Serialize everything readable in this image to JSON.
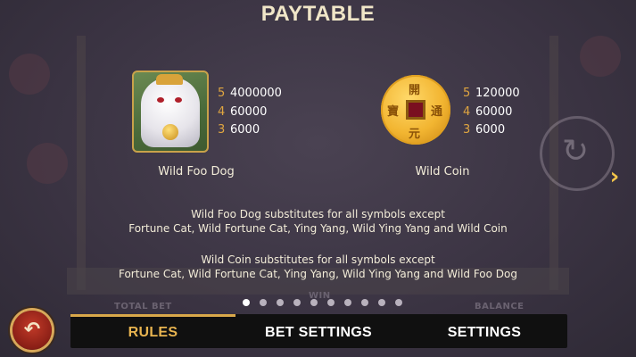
{
  "header": {
    "title": "PAYTABLE"
  },
  "symbols": [
    {
      "name": "Wild Foo Dog",
      "icon": "foo-dog-icon",
      "pays": [
        {
          "count": "5",
          "amount": "4000000"
        },
        {
          "count": "4",
          "amount": "60000"
        },
        {
          "count": "3",
          "amount": "6000"
        }
      ]
    },
    {
      "name": "Wild Coin",
      "icon": "coin-icon",
      "pays": [
        {
          "count": "5",
          "amount": "120000"
        },
        {
          "count": "4",
          "amount": "60000"
        },
        {
          "count": "3",
          "amount": "6000"
        }
      ]
    }
  ],
  "descriptions": {
    "foo_dog_line1": "Wild Foo Dog substitutes for all symbols except",
    "foo_dog_line2": "Fortune Cat, Wild Fortune Cat, Ying Yang, Wild Ying Yang and Wild Coin",
    "coin_line1": "Wild Coin substitutes for all symbols except",
    "coin_line2": "Fortune Cat, Wild Fortune Cat, Ying Yang, Wild Ying Yang and Wild Foo Dog"
  },
  "pagination": {
    "total_pages": 10,
    "current_page": 1
  },
  "menu": {
    "tabs": [
      "RULES",
      "BET SETTINGS",
      "SETTINGS"
    ],
    "active": "RULES"
  },
  "background_labels": {
    "total_bet": "TOTAL BET",
    "win": "WIN",
    "balance": "BALANCE"
  },
  "icons": {
    "back": "back-arrow-icon",
    "next": "chevron-right-icon"
  },
  "colors": {
    "accent": "#e8b450",
    "pay_count": "#e0a640",
    "menu_bg": "#101010"
  }
}
